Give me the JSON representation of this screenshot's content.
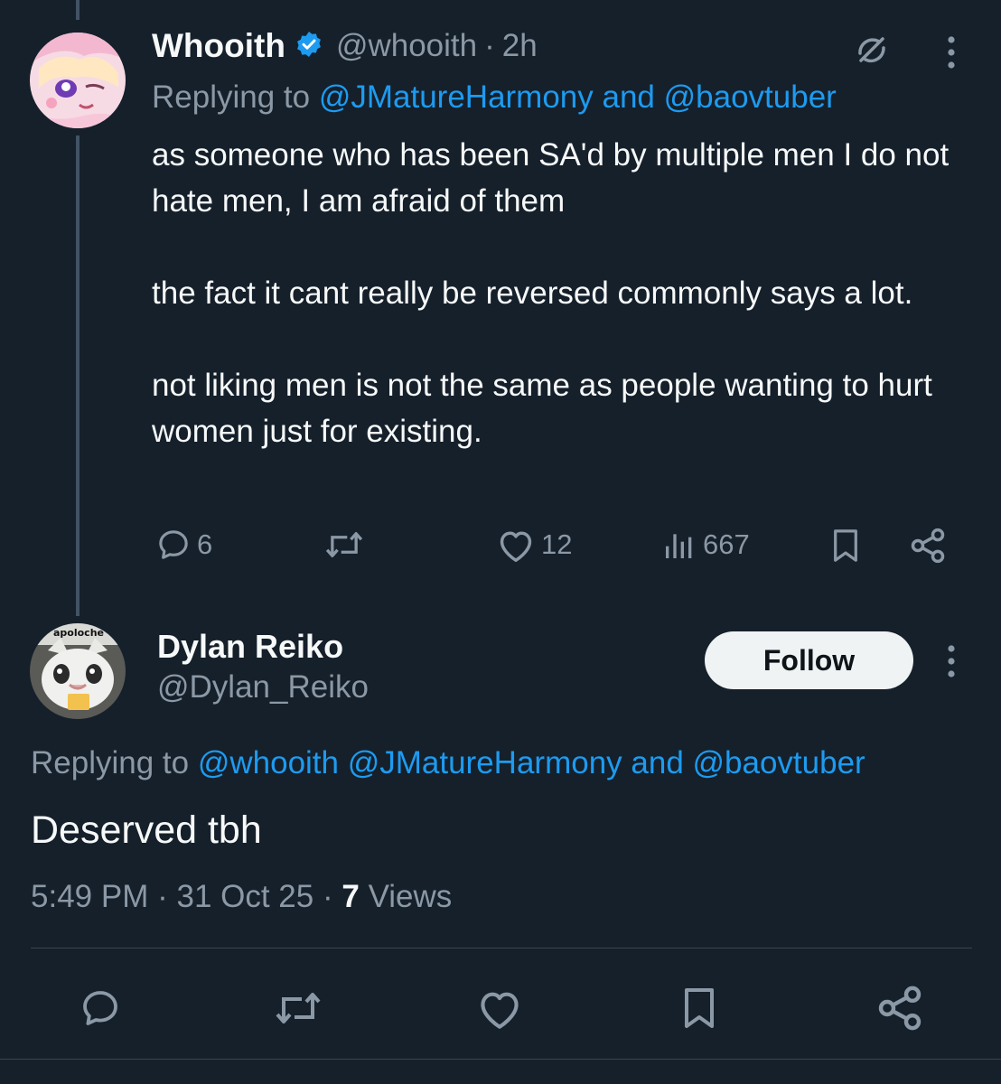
{
  "tweet": {
    "display_name": "Whooith",
    "handle": "@whooith",
    "separator": "·",
    "time": "2h",
    "replying_prefix": "Replying to ",
    "replying_mentions": "@JMatureHarmony and @baovtuber",
    "paragraphs": [
      "as someone who has been SA'd by multiple men I do not hate men, I am afraid of them",
      "the fact it cant really be reversed commonly says a lot.",
      "not liking men is not the same as people wanting to hurt women just for existing."
    ],
    "actions": {
      "replies": "6",
      "reposts": "",
      "likes": "12",
      "views": "667"
    }
  },
  "reply": {
    "display_name": "Dylan Reiko",
    "handle": "@Dylan_Reiko",
    "follow_label": "Follow",
    "avatar_text": "apoloche",
    "replying_prefix": "Replying to ",
    "replying_mentions": "@whooith @JMatureHarmony and @baovtuber",
    "text": "Deserved tbh",
    "time": "5:49 PM",
    "separator1": "·",
    "date": "31 Oct 25",
    "separator2": "·",
    "views_count": "7",
    "views_label": " Views"
  },
  "colors": {
    "background": "#15202b",
    "accent": "#1d9bf0",
    "muted": "#8b98a5",
    "thread_line": "#425364"
  },
  "icons": [
    "verified-badge-icon",
    "grok-icon",
    "more-icon",
    "reply-icon",
    "repost-icon",
    "like-icon",
    "views-icon",
    "bookmark-icon",
    "share-icon"
  ]
}
